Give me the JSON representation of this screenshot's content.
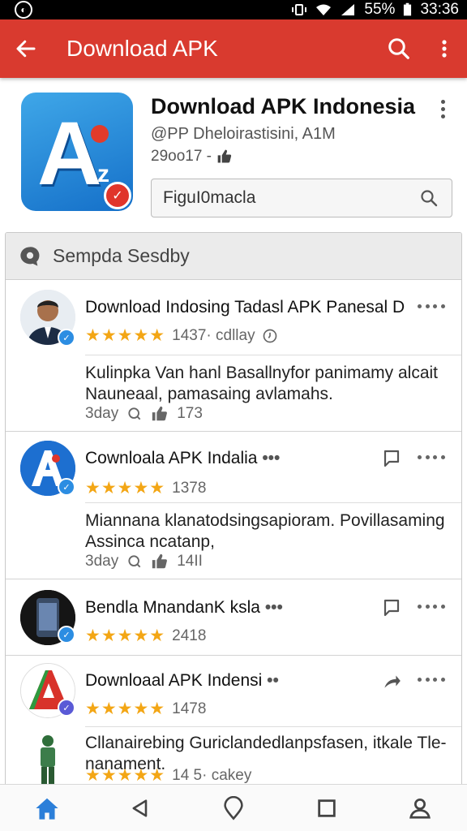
{
  "status_bar": {
    "battery": "55%",
    "time": "33:36"
  },
  "app_bar": {
    "title": "Download APK"
  },
  "app": {
    "title": "Download APK Indonesia",
    "developer": "@PP Dheloirastisini, A1M",
    "stats": "29oo17 -",
    "search_value": "FiguI0macla"
  },
  "section": {
    "title": "Sempda Sesdby"
  },
  "reviews": [
    {
      "name": "Download Indosing Tadasl APK Panesal D",
      "stars": "★★★★★",
      "meta": "1437·  cdllay",
      "body": "Kulinpka Van hanl Basallnyfor panimamy alcait Nauneaal, pamasaing avlamahs.",
      "time": "3day",
      "likes": "173"
    },
    {
      "name": "Cownloala APK Indalia",
      "stars": "★★★★★",
      "meta": "1378",
      "body": "Miannana klanatodsingsapioram. Povillasaming Assinca ncatanp,",
      "time": "3day",
      "likes": "14II"
    },
    {
      "name": "Bendla MnandanK ksla",
      "stars": "★★★★★",
      "meta": "2418"
    },
    {
      "name": "Downloaal APK Indensi",
      "stars": "★★★★★",
      "meta": "1478"
    },
    {
      "body": "Cllanairebing Guriclandedlanpsfasen, itkale Tle- nanament.",
      "stars": "★★★★★",
      "meta": "14 5·  cakey"
    }
  ],
  "colors": {
    "app_bar": "#d93a2f",
    "stars": "#f3a615",
    "verified": "#2c8de2",
    "nav_active": "#2c7fd9"
  }
}
